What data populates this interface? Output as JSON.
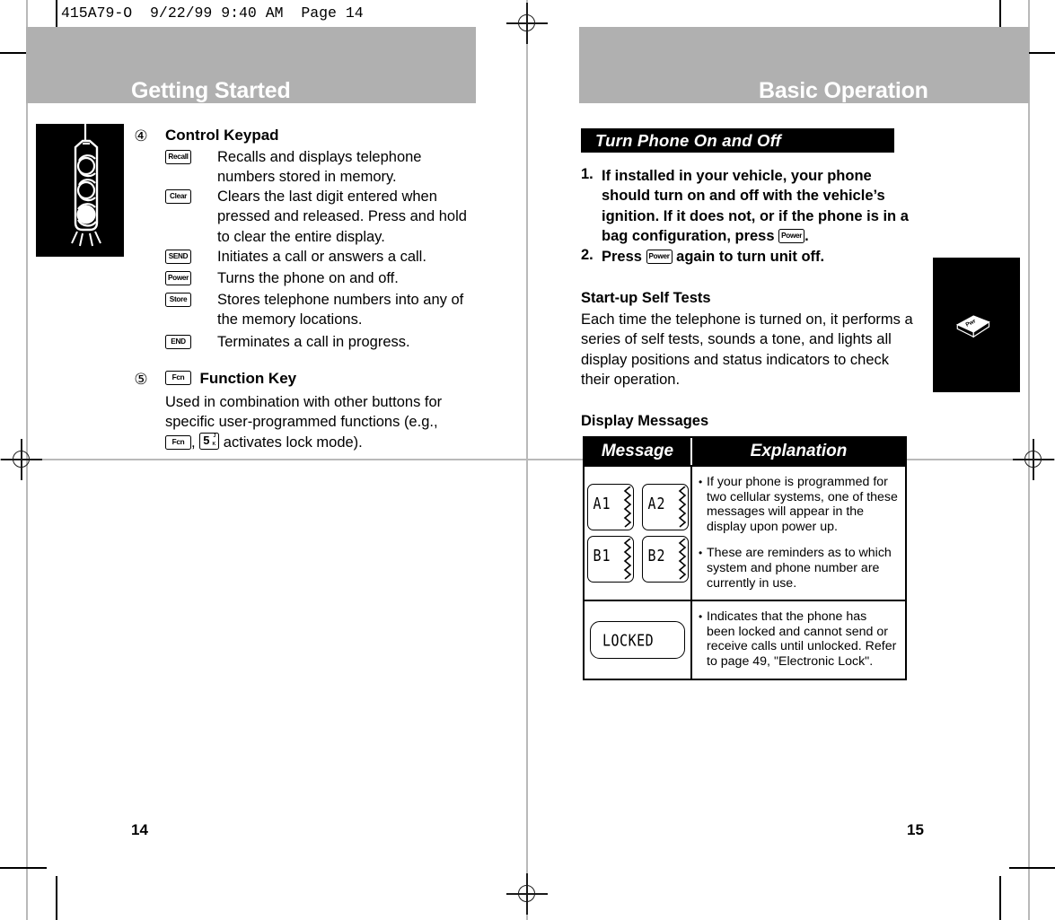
{
  "scan": {
    "header_line": "415A79-O  9/22/99 9:40 AM  Page 14"
  },
  "left_page": {
    "banner_title": "Getting Started",
    "folio": "14",
    "tab_icon": "signal-indicator-icon",
    "items": [
      {
        "number": "④",
        "heading": "Control Keypad",
        "rows": [
          {
            "key": "Recall",
            "desc": "Recalls and displays telephone numbers stored in memory."
          },
          {
            "key": "Clear",
            "desc": "Clears the last digit entered when pressed and released. Press and hold to clear the entire display."
          },
          {
            "key": "SEND",
            "desc": "Initiates a call or answers a call."
          },
          {
            "key": "Power",
            "desc": "Turns the phone on and off."
          },
          {
            "key": "Store",
            "desc": "Stores telephone numbers into any of the memory locations."
          },
          {
            "key": "END",
            "desc": "Terminates a call in progress."
          }
        ]
      },
      {
        "number": "⑤",
        "heading_key": "Fcn",
        "heading": "Function Key",
        "body_part1": "Used in combination with other buttons for specific user-programmed functions (e.g.,",
        "body_key1": "Fcn",
        "body_sep": ",",
        "body_key2": "5",
        "body_key2_sup": "J",
        "body_key2_sub": "K",
        "body_part2": "activates lock mode)."
      }
    ]
  },
  "right_page": {
    "banner_title": "Basic Operation",
    "folio": "15",
    "tab_icon": "power-key-icon",
    "tab_key_label": "Pwr",
    "section_bar": "Turn Phone On and Off",
    "steps": [
      {
        "num": "1.",
        "text_before": "If installed in your vehicle, your phone should turn on and off with the vehicle’s ignition. If it does not, or if the phone is in a bag configuration, press",
        "key": "Power",
        "text_after": "."
      },
      {
        "num": "2.",
        "text_before": "Press",
        "key": "Power",
        "text_after": "again to turn unit off."
      }
    ],
    "selftest": {
      "heading": "Start-up Self Tests",
      "body": "Each time the telephone is turned on, it performs a series of self tests, sounds a tone, and lights all display positions and status indicators to check their operation."
    },
    "display_messages": {
      "heading": "Display Messages",
      "columns": [
        "Message",
        "Explanation"
      ],
      "rows": [
        {
          "message_type": "lcd-grid",
          "lcd_values": [
            "A1",
            "A2",
            "B1",
            "B2"
          ],
          "bullets": [
            "If your phone is programmed for two cellular systems, one of these messages will appear in the display upon power up.",
            "These are reminders as to which system and phone number are currently in use."
          ]
        },
        {
          "message_type": "lcd-wide",
          "lcd_values": [
            "LOCKED"
          ],
          "bullets": [
            "Indicates that the phone has been locked and cannot send or receive calls until unlocked. Refer to page 49, \"Electronic Lock\"."
          ]
        }
      ]
    }
  },
  "colors": {
    "banner_gray": "#b0b0b0",
    "bar_black": "#000000",
    "guide_gray": "#b9b9b9"
  }
}
